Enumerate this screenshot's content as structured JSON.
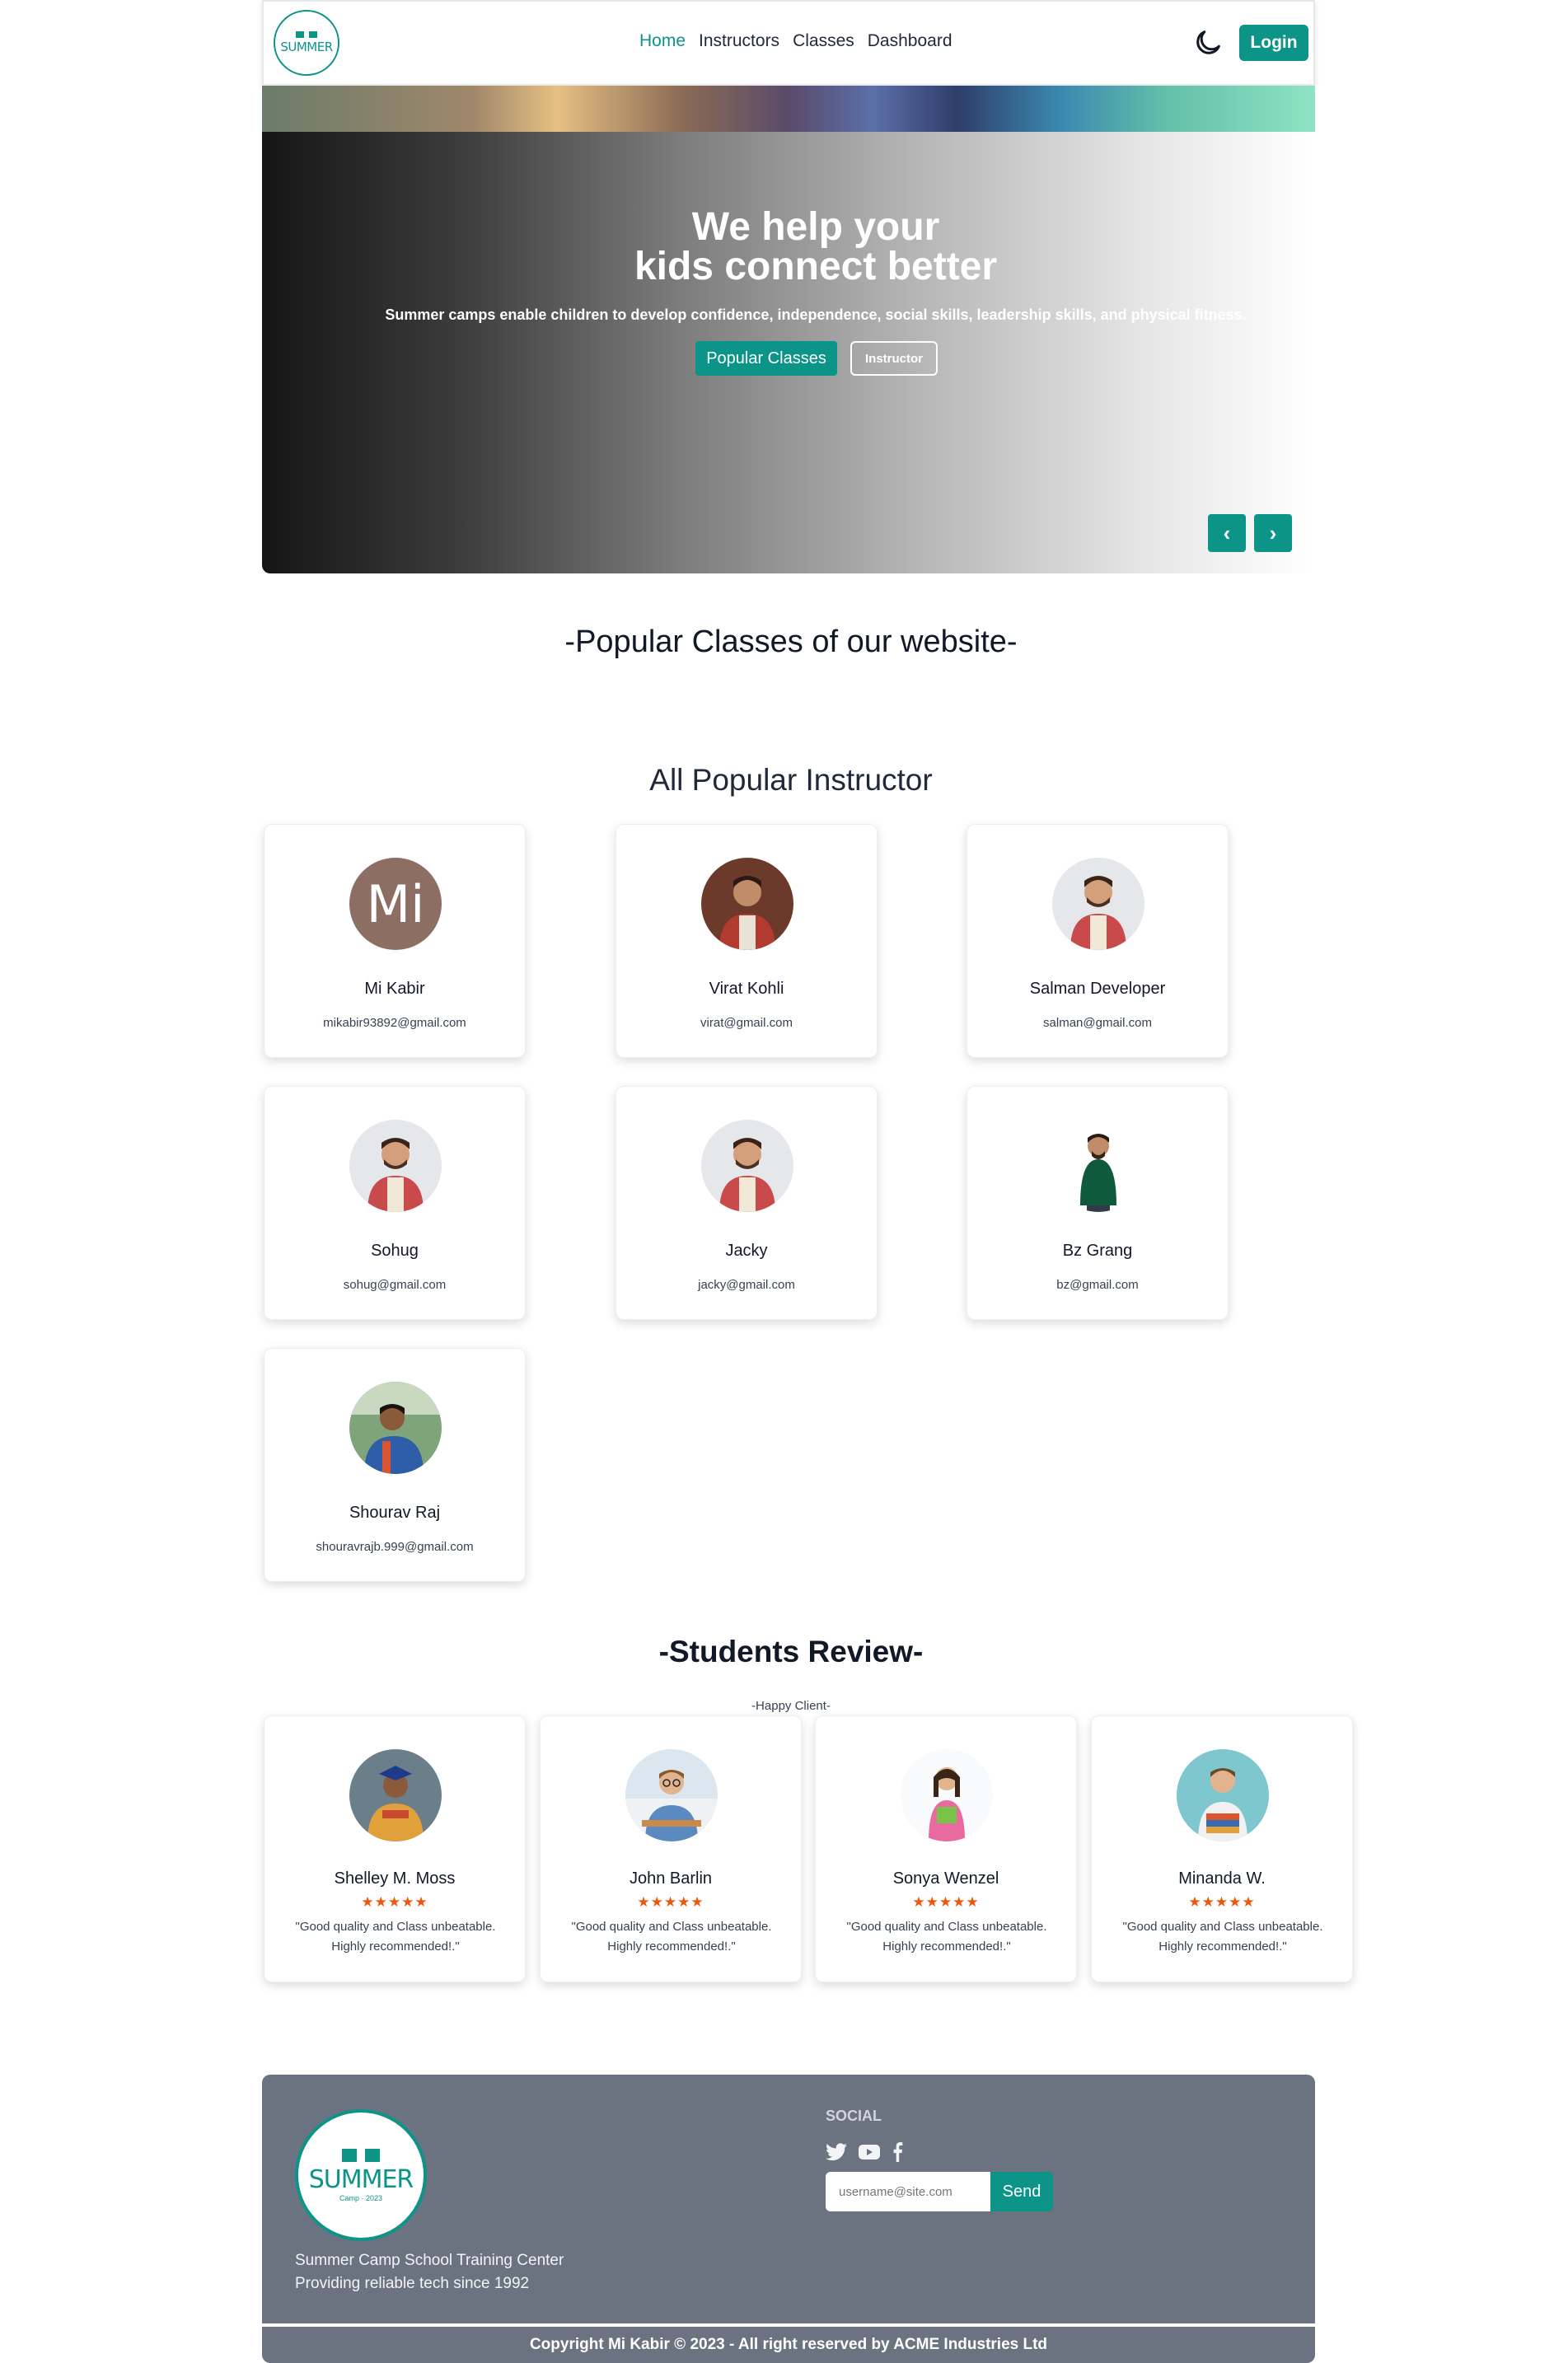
{
  "nav": {
    "logo_text": "SUMMER",
    "links": [
      "Home",
      "Instructors",
      "Classes",
      "Dashboard"
    ],
    "active_link": "Home",
    "login_label": "Login"
  },
  "hero": {
    "title_line1": "We help your",
    "title_line2": "kids connect better",
    "subtitle": "Summer camps enable children to develop confidence, independence, social skills, leadership skills, and physical fitness.",
    "popular_button": "Popular Classes",
    "instructor_button": "Instructor",
    "prev_arrow": "‹",
    "next_arrow": "›"
  },
  "popular_classes": {
    "heading": "-Popular Classes of our website-"
  },
  "instructors": {
    "heading": "All Popular Instructor",
    "items": [
      {
        "name": "Mi Kabir",
        "email": "mikabir93892@gmail.com",
        "avatar_initials": "Mi"
      },
      {
        "name": "Virat Kohli",
        "email": "virat@gmail.com"
      },
      {
        "name": "Salman Developer",
        "email": "salman@gmail.com"
      },
      {
        "name": "Sohug",
        "email": "sohug@gmail.com"
      },
      {
        "name": "Jacky",
        "email": "jacky@gmail.com"
      },
      {
        "name": "Bz Grang",
        "email": "bz@gmail.com"
      },
      {
        "name": "Shourav Raj",
        "email": "shouravrajb.999@gmail.com"
      }
    ]
  },
  "reviews": {
    "heading": "-Students Review-",
    "subheading": "-Happy Client-",
    "stars": "★★★★★",
    "items": [
      {
        "name": "Shelley M. Moss",
        "text": "\"Good quality and Class unbeatable. Highly recommended!.\""
      },
      {
        "name": "John Barlin",
        "text": "\"Good quality and Class unbeatable. Highly recommended!.\""
      },
      {
        "name": "Sonya Wenzel",
        "text": "\"Good quality and Class unbeatable. Highly recommended!.\""
      },
      {
        "name": "Minanda W.",
        "text": "\"Good quality and Class unbeatable. Highly recommended!.\""
      }
    ]
  },
  "footer": {
    "logo_text": "SUMMER",
    "logo_sub": "Camp · 2023",
    "tagline_line1": "Summer Camp School Training Center",
    "tagline_line2": "Providing reliable tech since 1992",
    "social_heading": "SOCIAL",
    "subscribe_placeholder": "username@site.com",
    "send_label": "Send",
    "copyright": "Copyright Mi Kabir © 2023 - All right reserved by ACME Industries Ltd"
  },
  "colors": {
    "accent": "#0d9488",
    "footer_bg": "#6b7280",
    "star": "#ea580c"
  }
}
